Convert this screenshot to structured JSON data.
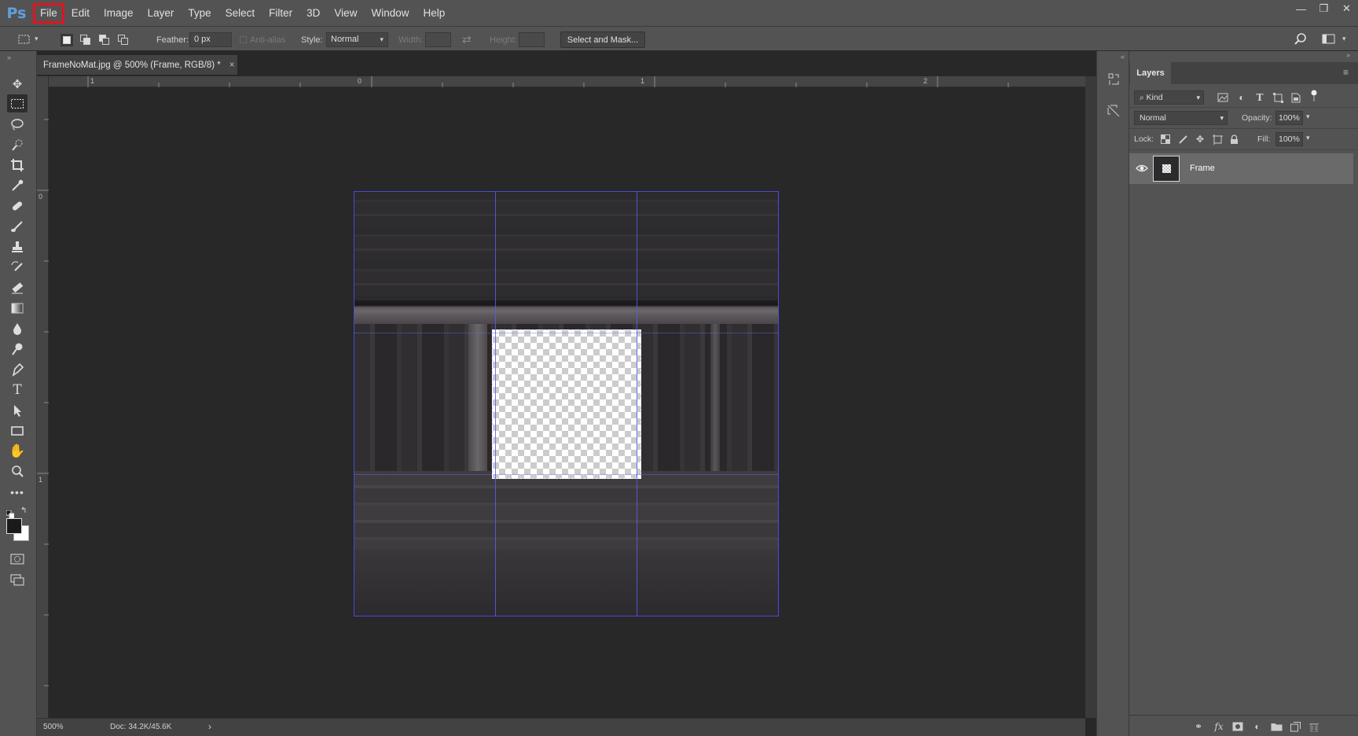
{
  "app": {
    "logo": "Ps"
  },
  "menu": [
    "File",
    "Edit",
    "Image",
    "Layer",
    "Type",
    "Select",
    "Filter",
    "3D",
    "View",
    "Window",
    "Help"
  ],
  "window_controls": {
    "minimize": "—",
    "restore": "❐",
    "close": "✕"
  },
  "options_bar": {
    "feather_label": "Feather:",
    "feather_value": "0 px",
    "antialias_label": "Anti-alias",
    "style_label": "Style:",
    "style_value": "Normal",
    "width_label": "Width:",
    "height_label": "Height:",
    "select_mask_label": "Select and Mask..."
  },
  "document": {
    "tab_title": "FrameNoMat.jpg @ 500% (Frame, RGB/8) *",
    "tab_close": "×"
  },
  "rulers": {
    "horizontal": [
      "1",
      "0",
      "1",
      "2"
    ],
    "vertical": [
      "0",
      "1"
    ]
  },
  "status": {
    "zoom": "500%",
    "doc_size": "Doc: 34.2K/45.6K",
    "arrow": "›"
  },
  "layers_panel": {
    "tab_label": "Layers",
    "kind_label": "Kind",
    "blend_mode": "Normal",
    "opacity_label": "Opacity:",
    "opacity_value": "100%",
    "lock_label": "Lock:",
    "fill_label": "Fill:",
    "fill_value": "100%",
    "layers": [
      {
        "name": "Frame",
        "visible": true
      }
    ]
  },
  "colors": {
    "accent_highlight": "#e0141e",
    "guide": "#5a5af0",
    "ps_logo": "#5fa0e0"
  }
}
